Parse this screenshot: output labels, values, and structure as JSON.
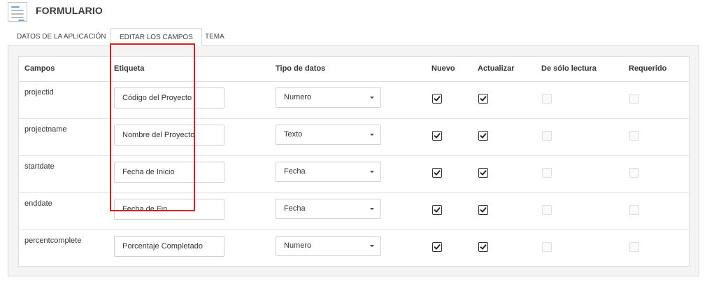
{
  "header": {
    "title": "FORMULARIO",
    "icon": "form-icon"
  },
  "tabs": [
    {
      "label": "DATOS DE LA APLICACIÓN",
      "active": false
    },
    {
      "label": "EDITAR LOS CAMPOS",
      "active": true
    },
    {
      "label": "TEMA",
      "active": false
    }
  ],
  "table": {
    "columns": [
      "Campos",
      "Etiqueta",
      "Tipo de datos",
      "Nuevo",
      "Actualizar",
      "De sólo lectura",
      "Requerido"
    ],
    "rows": [
      {
        "field": "projectid",
        "label": "Código del Proyecto",
        "type": "Numero",
        "nuevo": true,
        "actualizar": true,
        "solo_lectura": false,
        "requerido": false
      },
      {
        "field": "projectname",
        "label": "Nombre del Proyecto",
        "type": "Texto",
        "nuevo": true,
        "actualizar": true,
        "solo_lectura": false,
        "requerido": false
      },
      {
        "field": "startdate",
        "label": "Fecha de Inicio",
        "type": "Fecha",
        "nuevo": true,
        "actualizar": true,
        "solo_lectura": false,
        "requerido": false
      },
      {
        "field": "enddate",
        "label": "Fecha de Fin",
        "type": "Fecha",
        "nuevo": true,
        "actualizar": true,
        "solo_lectura": false,
        "requerido": false
      },
      {
        "field": "percentcomplete",
        "label": "Porcentaje Completado",
        "type": "Numero",
        "nuevo": true,
        "actualizar": true,
        "solo_lectura": false,
        "requerido": false
      }
    ]
  },
  "colors": {
    "highlight": "#d42020",
    "panel_bg": "#f4f4f4",
    "border": "#d6d6d6"
  }
}
